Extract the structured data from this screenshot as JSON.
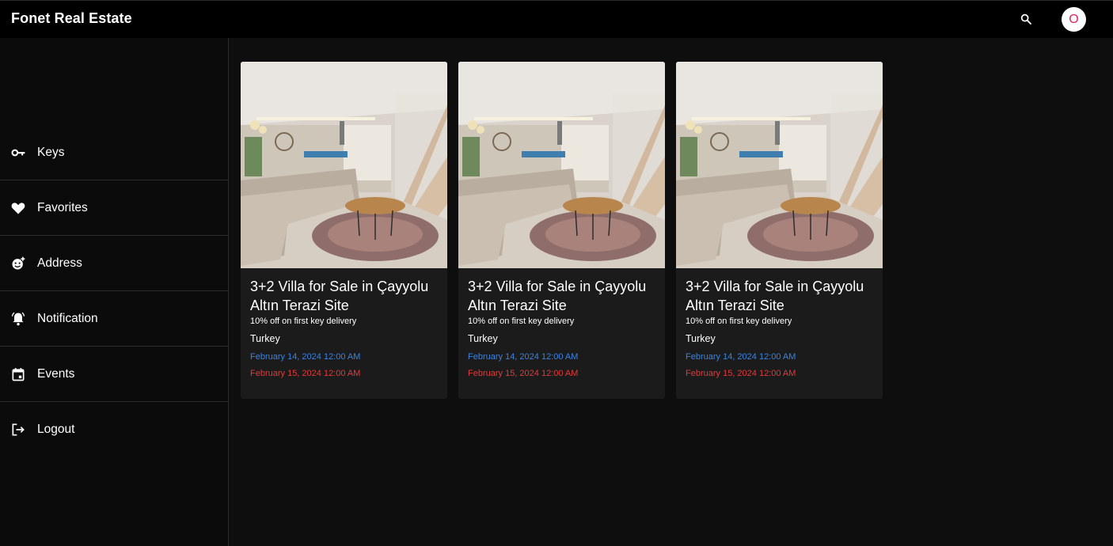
{
  "app": {
    "title": "Fonet Real Estate",
    "user_initial": "O",
    "colors": {
      "accent_pink": "#e0245e",
      "start_date": "#3a83e0",
      "end_date": "#e23a3a"
    }
  },
  "header": {
    "search_icon": "search-icon"
  },
  "sidebar": {
    "items": [
      {
        "label": "Keys",
        "icon": "key-icon"
      },
      {
        "label": "Favorites",
        "icon": "heart-icon"
      },
      {
        "label": "Address",
        "icon": "face-add-icon"
      },
      {
        "label": "Notification",
        "icon": "bell-icon"
      },
      {
        "label": "Events",
        "icon": "calendar-icon"
      },
      {
        "label": "Logout",
        "icon": "logout-icon"
      }
    ]
  },
  "listings": [
    {
      "title": "3+2 Villa for Sale in Çayyolu Altın Terazi Site",
      "offer": "10% off on first key delivery",
      "country": "Turkey",
      "start": "February 14, 2024 12:00 AM",
      "end": "February 15, 2024 12:00 AM"
    },
    {
      "title": "3+2 Villa for Sale in Çayyolu Altın Terazi Site",
      "offer": "10% off on first key delivery",
      "country": "Turkey",
      "start": "February 14, 2024 12:00 AM",
      "end": "February 15, 2024 12:00 AM"
    },
    {
      "title": "3+2 Villa for Sale in Çayyolu Altın Terazi Site",
      "offer": "10% off on first key delivery",
      "country": "Turkey",
      "start": "February 14, 2024 12:00 AM",
      "end": "February 15, 2024 12:00 AM"
    }
  ]
}
